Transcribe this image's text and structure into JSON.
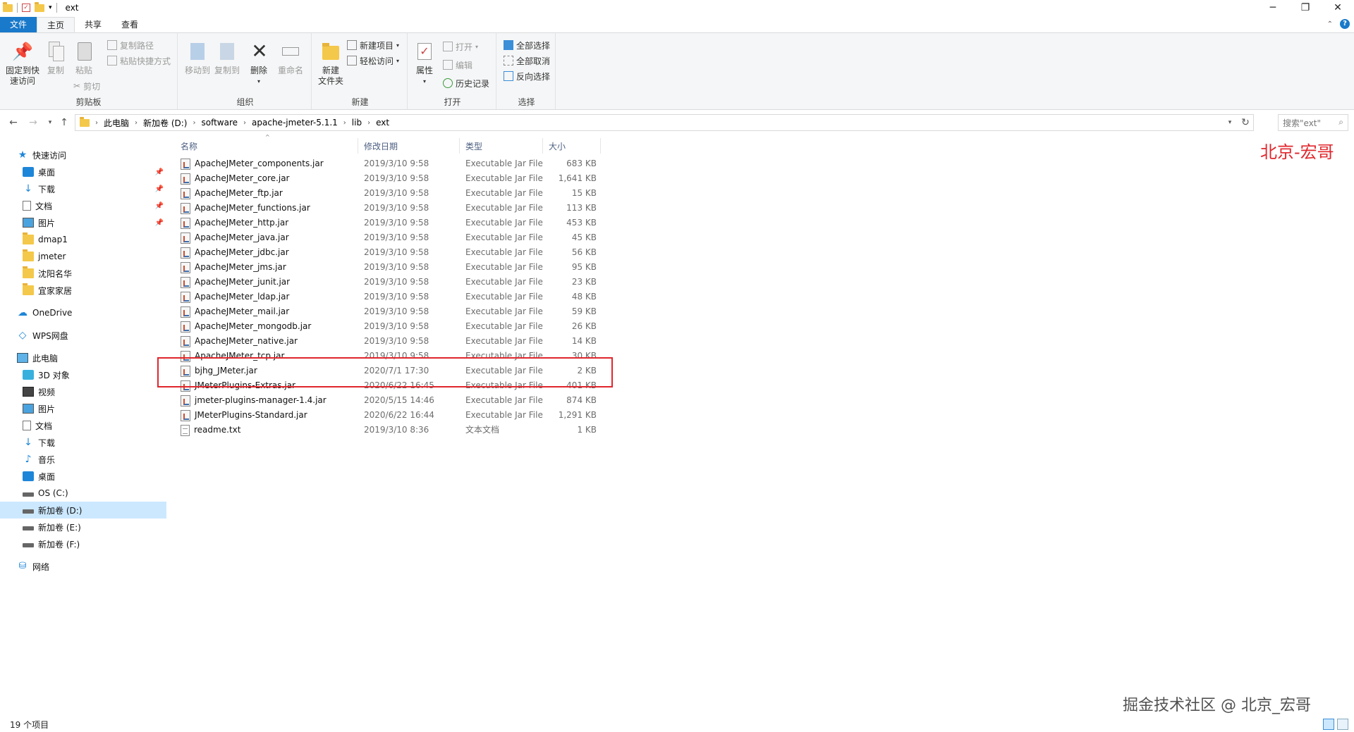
{
  "window": {
    "title": "ext",
    "controls": {
      "minimize": "─",
      "restore": "❐",
      "close": "✕"
    }
  },
  "ribbon_tabs": [
    {
      "label": "文件"
    },
    {
      "label": "主页"
    },
    {
      "label": "共享"
    },
    {
      "label": "查看"
    }
  ],
  "ribbon": {
    "clipboard": {
      "label": "剪贴板",
      "pin_label_1": "固定到快",
      "pin_label_2": "速访问",
      "copy_label": "复制",
      "paste_label": "粘贴",
      "copy_path": "复制路径",
      "paste_shortcut": "粘贴快捷方式",
      "cut": "剪切"
    },
    "organize": {
      "label": "组织",
      "move_to": "移动到",
      "copy_to": "复制到",
      "delete": "删除",
      "rename": "重命名"
    },
    "new": {
      "label": "新建",
      "new_folder_1": "新建",
      "new_folder_2": "文件夹",
      "new_item": "新建项目",
      "easy_access": "轻松访问"
    },
    "open": {
      "label": "打开",
      "properties": "属性",
      "open": "打开",
      "edit": "编辑",
      "history": "历史记录"
    },
    "select": {
      "label": "选择",
      "select_all": "全部选择",
      "select_none": "全部取消",
      "invert": "反向选择"
    }
  },
  "address": {
    "crumbs": [
      "此电脑",
      "新加卷 (D:)",
      "software",
      "apache-jmeter-5.1.1",
      "lib",
      "ext"
    ],
    "search_placeholder": "搜索\"ext\""
  },
  "nav": {
    "quick_access": "快速访问",
    "quick_items": [
      "桌面",
      "下载",
      "文档",
      "图片",
      "dmap1",
      "jmeter",
      "沈阳名华",
      "宜家家居"
    ],
    "onedrive": "OneDrive",
    "wps": "WPS网盘",
    "this_pc": "此电脑",
    "pc_items": [
      "3D 对象",
      "视频",
      "图片",
      "文档",
      "下载",
      "音乐",
      "桌面",
      "OS (C:)",
      "新加卷 (D:)",
      "新加卷 (E:)",
      "新加卷 (F:)"
    ],
    "network": "网络"
  },
  "columns": {
    "name": "名称",
    "date": "修改日期",
    "type": "类型",
    "size": "大小"
  },
  "files": [
    {
      "name": "ApacheJMeter_components.jar",
      "date": "2019/3/10 9:58",
      "type": "Executable Jar File",
      "size": "683 KB"
    },
    {
      "name": "ApacheJMeter_core.jar",
      "date": "2019/3/10 9:58",
      "type": "Executable Jar File",
      "size": "1,641 KB"
    },
    {
      "name": "ApacheJMeter_ftp.jar",
      "date": "2019/3/10 9:58",
      "type": "Executable Jar File",
      "size": "15 KB"
    },
    {
      "name": "ApacheJMeter_functions.jar",
      "date": "2019/3/10 9:58",
      "type": "Executable Jar File",
      "size": "113 KB"
    },
    {
      "name": "ApacheJMeter_http.jar",
      "date": "2019/3/10 9:58",
      "type": "Executable Jar File",
      "size": "453 KB"
    },
    {
      "name": "ApacheJMeter_java.jar",
      "date": "2019/3/10 9:58",
      "type": "Executable Jar File",
      "size": "45 KB"
    },
    {
      "name": "ApacheJMeter_jdbc.jar",
      "date": "2019/3/10 9:58",
      "type": "Executable Jar File",
      "size": "56 KB"
    },
    {
      "name": "ApacheJMeter_jms.jar",
      "date": "2019/3/10 9:58",
      "type": "Executable Jar File",
      "size": "95 KB"
    },
    {
      "name": "ApacheJMeter_junit.jar",
      "date": "2019/3/10 9:58",
      "type": "Executable Jar File",
      "size": "23 KB"
    },
    {
      "name": "ApacheJMeter_ldap.jar",
      "date": "2019/3/10 9:58",
      "type": "Executable Jar File",
      "size": "48 KB"
    },
    {
      "name": "ApacheJMeter_mail.jar",
      "date": "2019/3/10 9:58",
      "type": "Executable Jar File",
      "size": "59 KB"
    },
    {
      "name": "ApacheJMeter_mongodb.jar",
      "date": "2019/3/10 9:58",
      "type": "Executable Jar File",
      "size": "26 KB"
    },
    {
      "name": "ApacheJMeter_native.jar",
      "date": "2019/3/10 9:58",
      "type": "Executable Jar File",
      "size": "14 KB"
    },
    {
      "name": "ApacheJMeter_tcp.jar",
      "date": "2019/3/10 9:58",
      "type": "Executable Jar File",
      "size": "30 KB"
    },
    {
      "name": "bjhg_JMeter.jar",
      "date": "2020/7/1 17:30",
      "type": "Executable Jar File",
      "size": "2 KB"
    },
    {
      "name": "JMeterPlugins-Extras.jar",
      "date": "2020/6/22 16:45",
      "type": "Executable Jar File",
      "size": "401 KB"
    },
    {
      "name": "jmeter-plugins-manager-1.4.jar",
      "date": "2020/5/15 14:46",
      "type": "Executable Jar File",
      "size": "874 KB"
    },
    {
      "name": "JMeterPlugins-Standard.jar",
      "date": "2020/6/22 16:44",
      "type": "Executable Jar File",
      "size": "1,291 KB"
    },
    {
      "name": "readme.txt",
      "date": "2019/3/10 8:36",
      "type": "文本文档",
      "size": "1 KB"
    }
  ],
  "status": {
    "count": "19 个项目"
  },
  "watermarks": {
    "top": "北京-宏哥",
    "bottom": "掘金技术社区 @ 北京_宏哥"
  },
  "colors": {
    "accent": "#1979ca",
    "highlight": "#e0262c",
    "selected": "#cce8ff"
  }
}
